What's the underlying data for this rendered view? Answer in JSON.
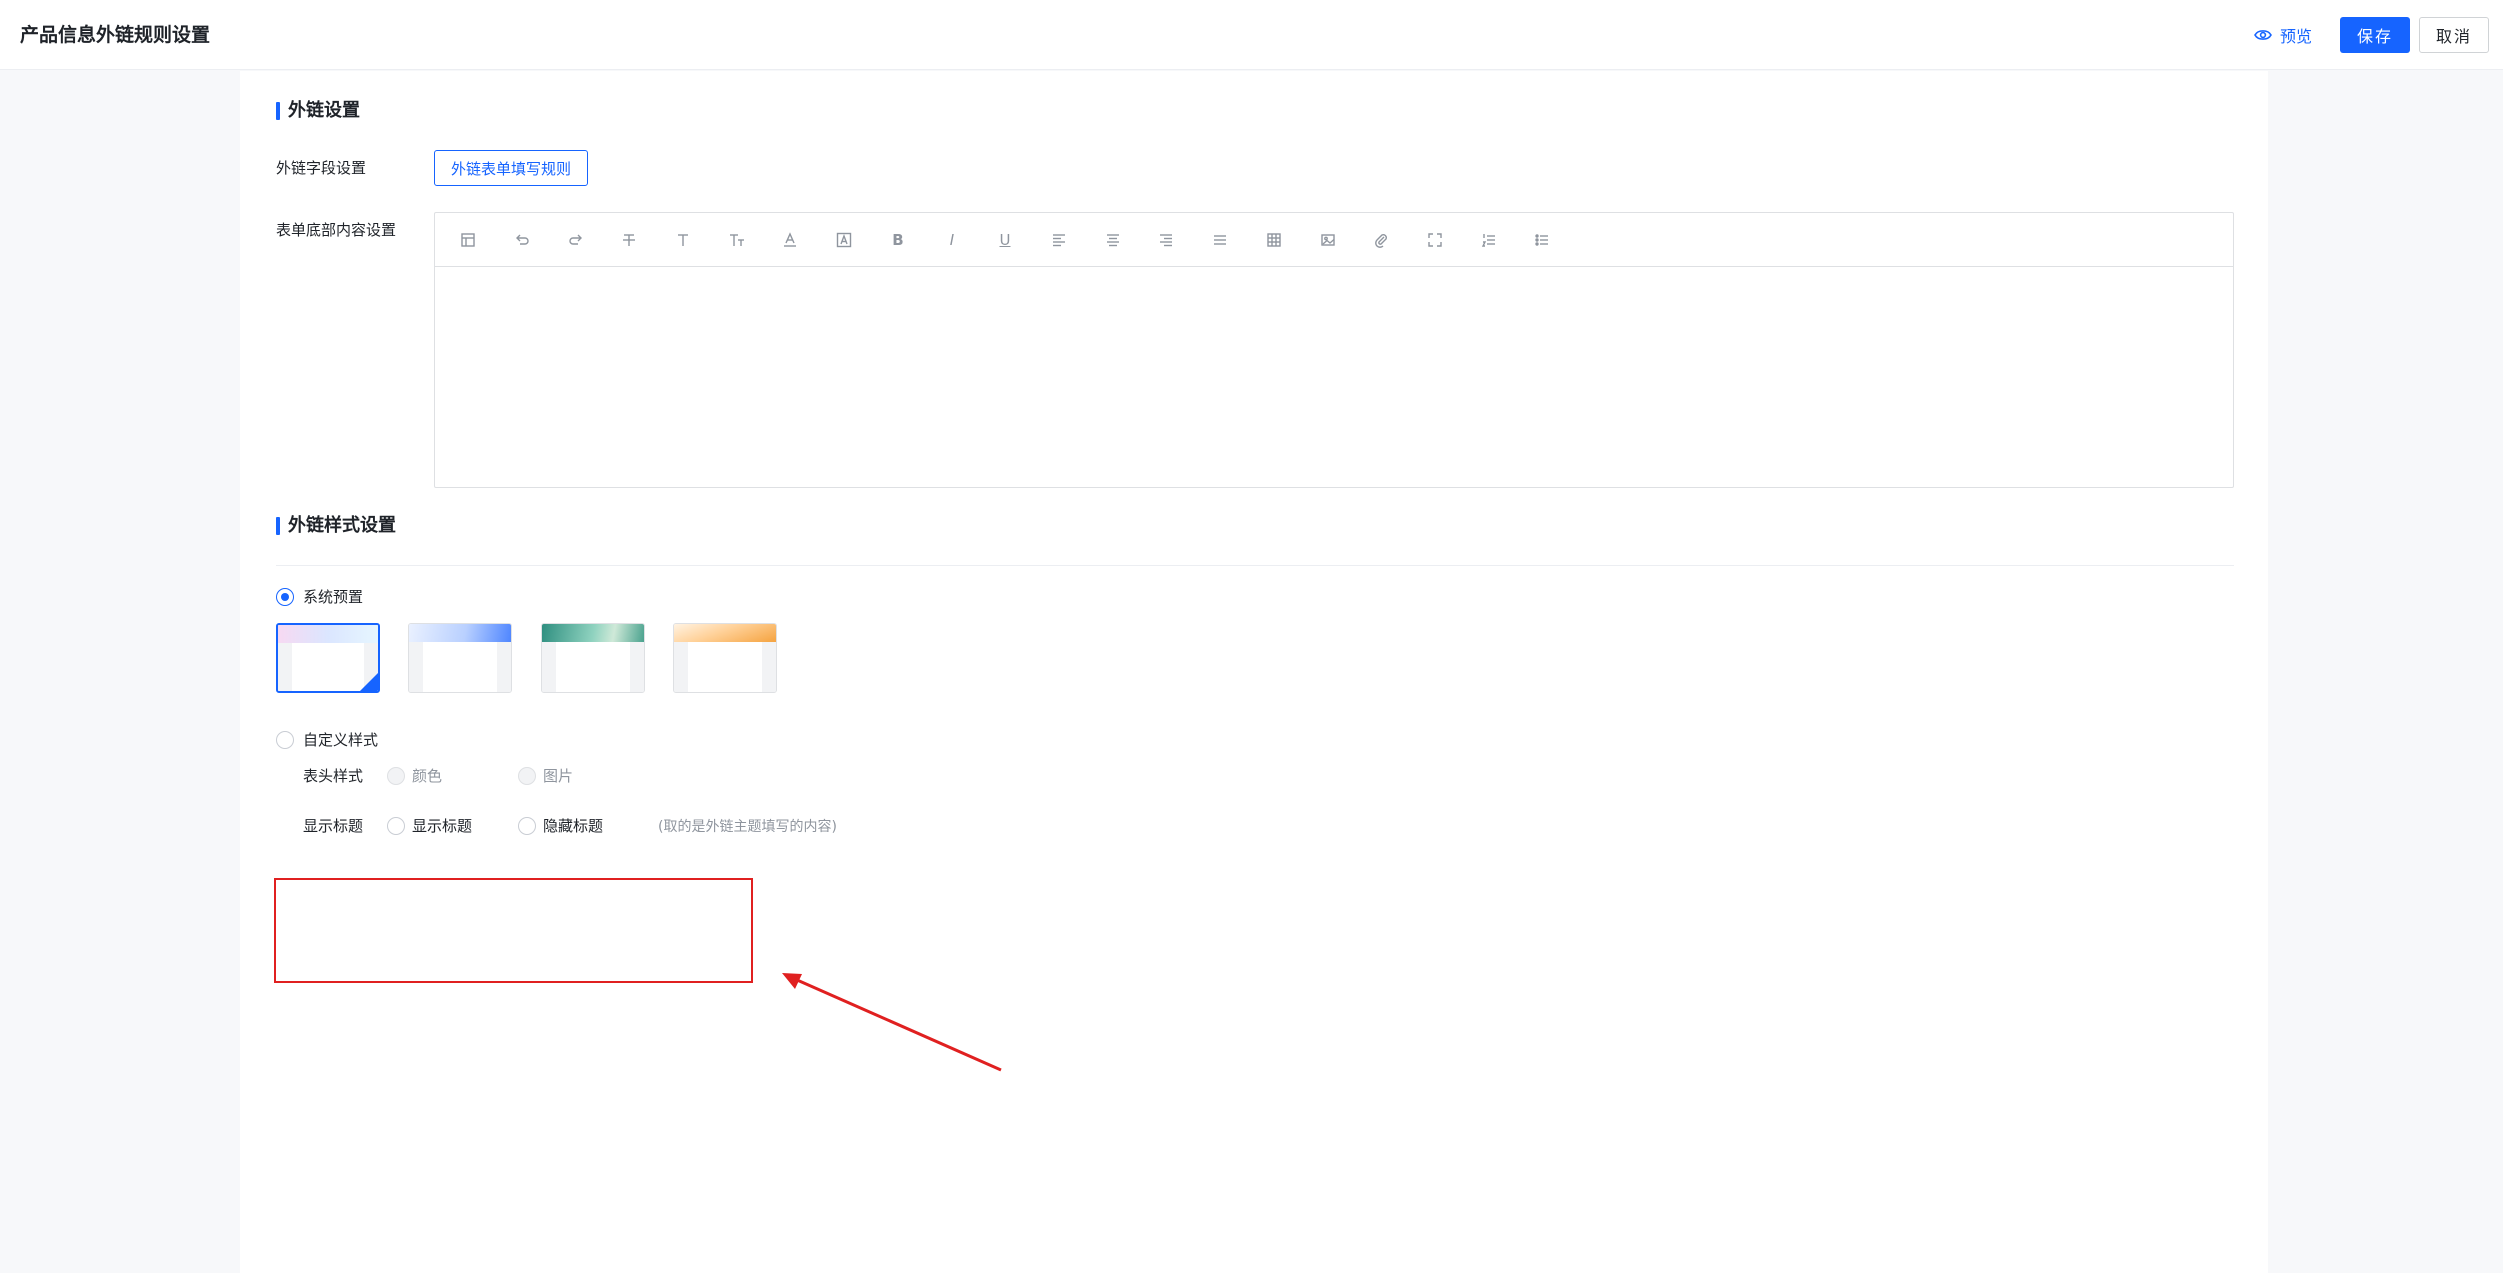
{
  "header": {
    "title": "产品信息外链规则设置",
    "preview_label": "预览",
    "save_label": "保存",
    "cancel_label": "取消"
  },
  "link_settings": {
    "section_title": "外链设置",
    "field_label": "外链字段设置",
    "field_button": "外链表单填写规则",
    "footer_label": "表单底部内容设置",
    "toolbar_icons": [
      "template-icon",
      "undo-icon",
      "redo-icon",
      "strikethrough-icon",
      "font-size-icon",
      "text-size-icon",
      "font-color-icon",
      "background-color-icon",
      "bold-icon",
      "italic-icon",
      "underline-icon",
      "align-left-icon",
      "align-center-icon",
      "align-right-icon",
      "justify-icon",
      "table-icon",
      "image-icon",
      "attachment-icon",
      "fullscreen-icon",
      "ordered-list-icon",
      "unordered-list-icon"
    ]
  },
  "style_settings": {
    "section_title": "外链样式设置",
    "preset_label": "系统预置",
    "presets": [
      {
        "name": "preset-pastel",
        "color": "#e6eaff",
        "selected": true
      },
      {
        "name": "preset-blue",
        "color": "#7fa7ff",
        "selected": false
      },
      {
        "name": "preset-green",
        "color": "#5fb59e",
        "selected": false
      },
      {
        "name": "preset-orange",
        "color": "#f5a340",
        "selected": false
      }
    ],
    "custom_label": "自定义样式",
    "header_style_label": "表头样式",
    "header_style_options": [
      "颜色",
      "图片"
    ],
    "show_title_label": "显示标题",
    "show_title_options": [
      "显示标题",
      "隐藏标题"
    ],
    "show_title_hint": "(取的是外链主题填写的内容)"
  },
  "colors": {
    "accent": "#1664ff",
    "annotation": "#e02020"
  }
}
